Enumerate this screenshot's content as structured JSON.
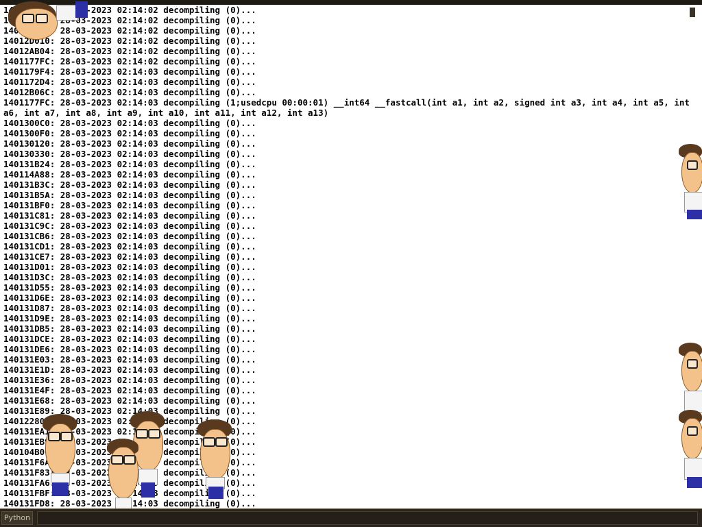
{
  "console": {
    "lines": [
      "140131D04: 28-03-2023 02:14:02 decompiling (0)...",
      "140131D24: 28-03-2023 02:14:02 decompiling (0)...",
      "140131D44: 28-03-2023 02:14:02 decompiling (0)...",
      "14012D010: 28-03-2023 02:14:02 decompiling (0)...",
      "14012AB04: 28-03-2023 02:14:02 decompiling (0)...",
      "1401177FC: 28-03-2023 02:14:02 decompiling (0)...",
      "1401179F4: 28-03-2023 02:14:03 decompiling (0)...",
      "1401172D4: 28-03-2023 02:14:03 decompiling (0)...",
      "14012B06C: 28-03-2023 02:14:03 decompiling (0)...",
      "1401177FC: 28-03-2023 02:14:03 decompiling (1;usedcpu 00:00:01) __int64 __fastcall(int a1, int a2, signed int a3, int a4, int a5, int a6, int a7, int a8, int a9, int a10, int a11, int a12, int a13)",
      "1401300C0: 28-03-2023 02:14:03 decompiling (0)...",
      "1401300F0: 28-03-2023 02:14:03 decompiling (0)...",
      "140130120: 28-03-2023 02:14:03 decompiling (0)...",
      "140130330: 28-03-2023 02:14:03 decompiling (0)...",
      "140131B24: 28-03-2023 02:14:03 decompiling (0)...",
      "140114A88: 28-03-2023 02:14:03 decompiling (0)...",
      "140131B3C: 28-03-2023 02:14:03 decompiling (0)...",
      "140131B5A: 28-03-2023 02:14:03 decompiling (0)...",
      "140131BF0: 28-03-2023 02:14:03 decompiling (0)...",
      "140131C81: 28-03-2023 02:14:03 decompiling (0)...",
      "140131C9C: 28-03-2023 02:14:03 decompiling (0)...",
      "140131CB6: 28-03-2023 02:14:03 decompiling (0)...",
      "140131CD1: 28-03-2023 02:14:03 decompiling (0)...",
      "140131CE7: 28-03-2023 02:14:03 decompiling (0)...",
      "140131D01: 28-03-2023 02:14:03 decompiling (0)...",
      "140131D3C: 28-03-2023 02:14:03 decompiling (0)...",
      "140131D55: 28-03-2023 02:14:03 decompiling (0)...",
      "140131D6E: 28-03-2023 02:14:03 decompiling (0)...",
      "140131D87: 28-03-2023 02:14:03 decompiling (0)...",
      "140131D9E: 28-03-2023 02:14:03 decompiling (0)...",
      "140131DB5: 28-03-2023 02:14:03 decompiling (0)...",
      "140131DCE: 28-03-2023 02:14:03 decompiling (0)...",
      "140131DE6: 28-03-2023 02:14:03 decompiling (0)...",
      "140131E03: 28-03-2023 02:14:03 decompiling (0)...",
      "140131E1D: 28-03-2023 02:14:03 decompiling (0)...",
      "140131E36: 28-03-2023 02:14:03 decompiling (0)...",
      "140131E4F: 28-03-2023 02:14:03 decompiling (0)...",
      "140131E68: 28-03-2023 02:14:03 decompiling (0)...",
      "140131E89: 28-03-2023 02:14:03 decompiling (0)...",
      "140122800: 28-03-2023 02:14:03 decompiling (0)...",
      "140131EA1: 28-03-2023 02:14:03 decompiling (0)...",
      "140131EB9: 28-03-2023 02:14:03 decompiling (0)...",
      "140104B00: 28-03-2023 02:14:03 decompiling (0)...",
      "140131F6A: 28-03-2023 02:14:03 decompiling (0)...",
      "140131F83: 28-03-2023 02:14:03 decompiling (0)...",
      "140131FA6: 28-03-2023 02:14:03 decompiling (0)...",
      "140131FBF: 28-03-2023 02:14:03 decompiling (0)...",
      "140131FD8: 28-03-2023 02:14:03 decompiling (0)..."
    ]
  },
  "bottom_bar": {
    "language_button": "Python",
    "command_input_value": ""
  },
  "colors": {
    "console_background": "#ffffff",
    "console_text": "#000000",
    "chrome_background": "#1e1a14",
    "mascot_pants": "#2c2fa6"
  }
}
